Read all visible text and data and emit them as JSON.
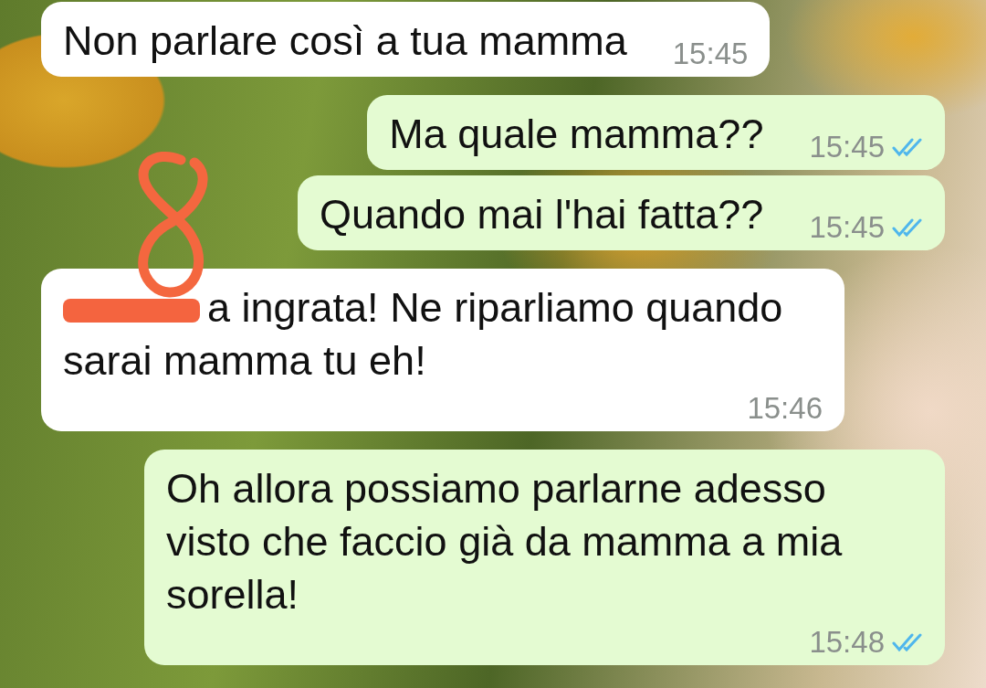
{
  "messages": [
    {
      "kind": "incoming",
      "text": "Non parlare così a tua mamma",
      "time": "15:45",
      "redacted": false
    },
    {
      "kind": "outgoing",
      "text": "Ma quale mamma??",
      "time": "15:45",
      "read": true
    },
    {
      "kind": "outgoing",
      "text": "Quando mai l'hai fatta??",
      "time": "15:45",
      "read": true
    },
    {
      "kind": "incoming",
      "text": "a ingrata! Ne riparliamo quando sarai mamma tu eh!",
      "time": "15:46",
      "redacted": true
    },
    {
      "kind": "outgoing",
      "text": "Oh allora possiamo parlarne adesso visto che faccio già da mamma a mia sorella!",
      "time": "15:48",
      "read": true
    }
  ]
}
